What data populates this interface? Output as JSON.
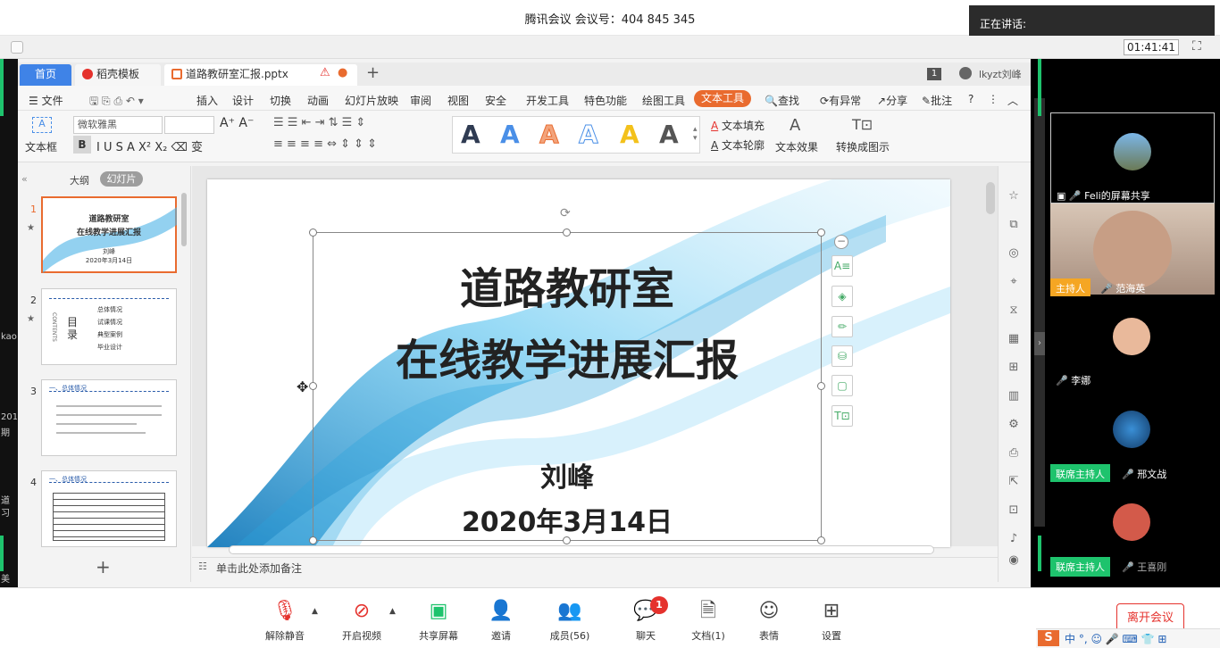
{
  "meeting": {
    "title": "腾讯会议 会议号：404 845 345",
    "speaking_label": "正在讲话:",
    "timer": "01:41:41"
  },
  "left_fragments": [
    "kao",
    "201",
    "期",
    "道",
    "习",
    "美"
  ],
  "wps": {
    "tabs": {
      "home": "首页",
      "template": "稻壳模板",
      "file": "道路教研室汇报.pptx",
      "plus": "+"
    },
    "page_indicator": "1",
    "user": "lkyzt刘峰",
    "menu": {
      "file": "文件",
      "insert": "插入",
      "design": "设计",
      "transition": "切换",
      "animation": "动画",
      "slideshow": "幻灯片放映",
      "review": "审阅",
      "view": "视图",
      "security": "安全",
      "devtools": "开发工具",
      "features": "特色功能",
      "drawing": "绘图工具",
      "texttool": "文本工具",
      "search": "查找",
      "changes": "有异常",
      "share": "分享",
      "comment": "批注",
      "help": "?"
    },
    "tools": {
      "textbox": "文本框",
      "font": "微软雅黑",
      "fill": "文本填充",
      "outline": "文本轮廓",
      "effect": "文本效果",
      "convert": "转换成图示"
    },
    "gallery_letter": "A",
    "panel": {
      "outline_tab": "大纲",
      "slides_tab": "幻灯片",
      "add": "+"
    },
    "thumbs": [
      {
        "num": "1",
        "title": "道路教研室",
        "subtitle": "在线教学进展汇报",
        "author": "刘峰",
        "date": "2020年3月14日"
      },
      {
        "num": "2",
        "contents": "CONTENTS",
        "heading": "目 录",
        "items": [
          "总体情况",
          "试课情况",
          "典型案例",
          "毕业设计"
        ]
      },
      {
        "num": "3",
        "heading": "一、总体情况"
      },
      {
        "num": "4",
        "heading": "一、总体情况"
      }
    ],
    "slide": {
      "title1": "道路教研室",
      "title2": "在线教学进展汇报",
      "author": "刘峰",
      "date": "2020年3月14日"
    },
    "notes": "单击此处添加备注"
  },
  "participants": [
    {
      "name": "Feli的屏幕共享",
      "role": ""
    },
    {
      "name": "范海英",
      "role": "主持人"
    },
    {
      "name": "李娜",
      "role": ""
    },
    {
      "name": "邢文战",
      "role": "联席主持人"
    },
    {
      "name": "王喜刚",
      "role": "联席主持人"
    }
  ],
  "bottom": {
    "unmute": "解除静音",
    "video": "开启视频",
    "share": "共享屏幕",
    "invite": "邀请",
    "members": "成员(56)",
    "chat": "聊天",
    "chat_badge": "1",
    "docs": "文档(1)",
    "reactions": "表情",
    "settings": "设置",
    "leave": "离开会议"
  },
  "ime": {
    "text": "中 °, ☺ 🎤 ⌨ 👕 ⊞"
  },
  "colors": {
    "accent_orange": "#e96b2f",
    "wps_blue": "#3f83e7",
    "green": "#1ec36d",
    "host_orange": "#f5a623",
    "red": "#e5322d"
  }
}
